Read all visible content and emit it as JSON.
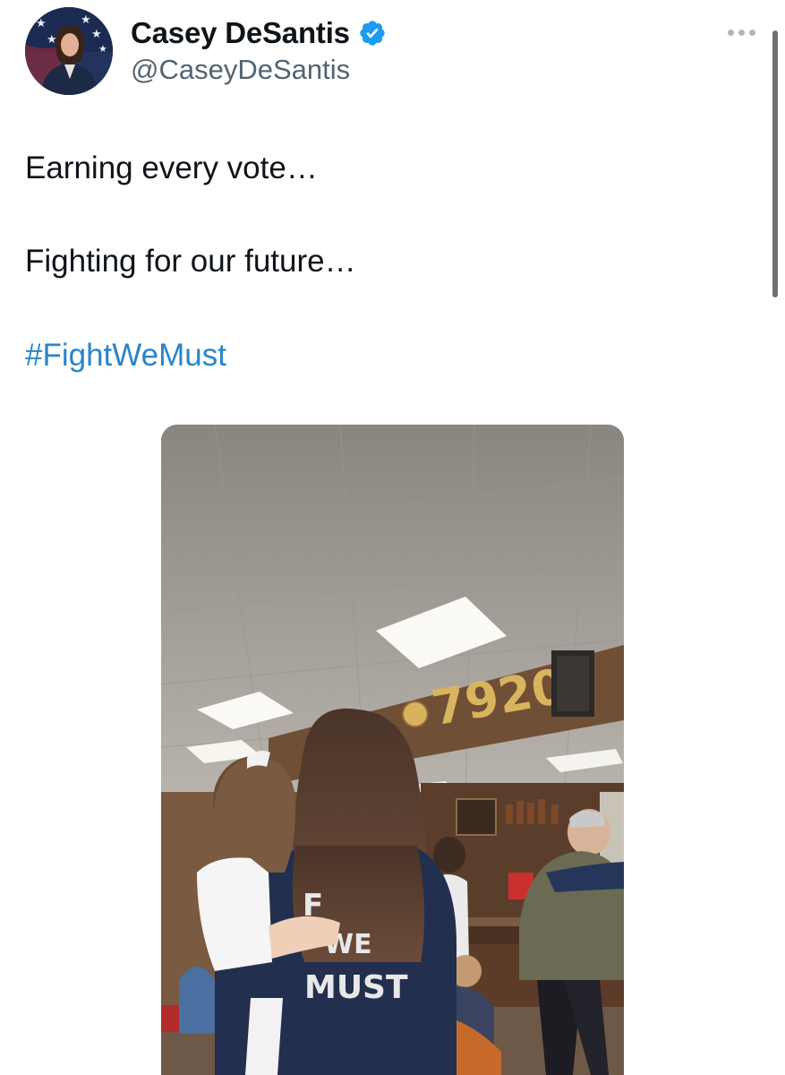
{
  "author": {
    "display_name": "Casey DeSantis",
    "handle": "@CaseyDeSantis",
    "verified": true,
    "avatar_icon": "profile-photo"
  },
  "tweet": {
    "lines": [
      "Earning every vote…",
      "Fighting for our future…"
    ],
    "hashtag": "#FightWeMust",
    "hashtag_color": "#2a85c9"
  },
  "media": {
    "type": "video-thumbnail",
    "wall_number": "7920",
    "jacket_text_top": "F",
    "jacket_text_middle": "WE",
    "jacket_text_bottom": "MUST"
  },
  "icons": {
    "more": "more-horizontal-icon",
    "verified": "verified-badge-icon"
  },
  "colors": {
    "verified_badge": "#1d9bf0",
    "handle": "#536471"
  }
}
